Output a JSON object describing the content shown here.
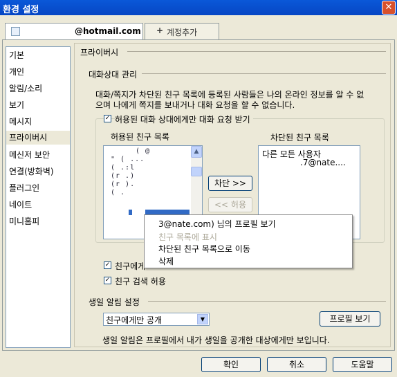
{
  "window": {
    "title": "환경 설정",
    "close_icon": "close-icon"
  },
  "accounts": {
    "email": "@hotmail.com",
    "add_label": "계정추가"
  },
  "sidebar": {
    "items": [
      {
        "label": "기본"
      },
      {
        "label": "개인"
      },
      {
        "label": "알림/소리"
      },
      {
        "label": "보기"
      },
      {
        "label": "메시지"
      },
      {
        "label": "프라이버시"
      },
      {
        "label": "메신저 보안"
      },
      {
        "label": "연결(방화벽)"
      },
      {
        "label": "플러그인"
      },
      {
        "label": "네이트"
      },
      {
        "label": "미니홈피"
      }
    ]
  },
  "privacy": {
    "section_title": "프라이버시",
    "contacts_heading": "대화상대 관리",
    "description_line1": "대화/쪽지가 차단된 친구 목록에 등록된 사람들은 나의 온라인 정보를 알 수 없",
    "description_line2": "으며 나에게 쪽지를 보내거나 대화 요청을 할 수 없습니다.",
    "allow_only_label": "허용된 대화 상대에게만 대화 요청 받기",
    "allowed_list_title": "허용된 친구 목록",
    "blocked_list_title": "차단된 친구 목록",
    "blocked_items": [
      "다른 모든 사용자",
      ".7@nate...."
    ],
    "block_button": "차단 >>",
    "allow_button": "<< 허용",
    "friend_check_label": "친구에게",
    "friend_search_label": "친구 검색 허용",
    "birthday_heading": "생일 알림 설정",
    "birthday_select_value": "친구에게만 공개",
    "profile_button": "프로필 보기",
    "birthday_note": "생일 알림은 프로필에서 내가 생일을 공개한 대상에게만 보입니다."
  },
  "context_menu": {
    "items": [
      "3@nate.com) 님의 프로필 보기",
      "친구 목록에 표시",
      "차단된 친구 목록으로 이동",
      "삭제"
    ]
  },
  "footer": {
    "ok": "확인",
    "cancel": "취소",
    "help": "도움말"
  },
  "colors": {
    "titlebar": "#0a58d8",
    "panel": "#ece9d8",
    "selection": "#316ac5"
  }
}
